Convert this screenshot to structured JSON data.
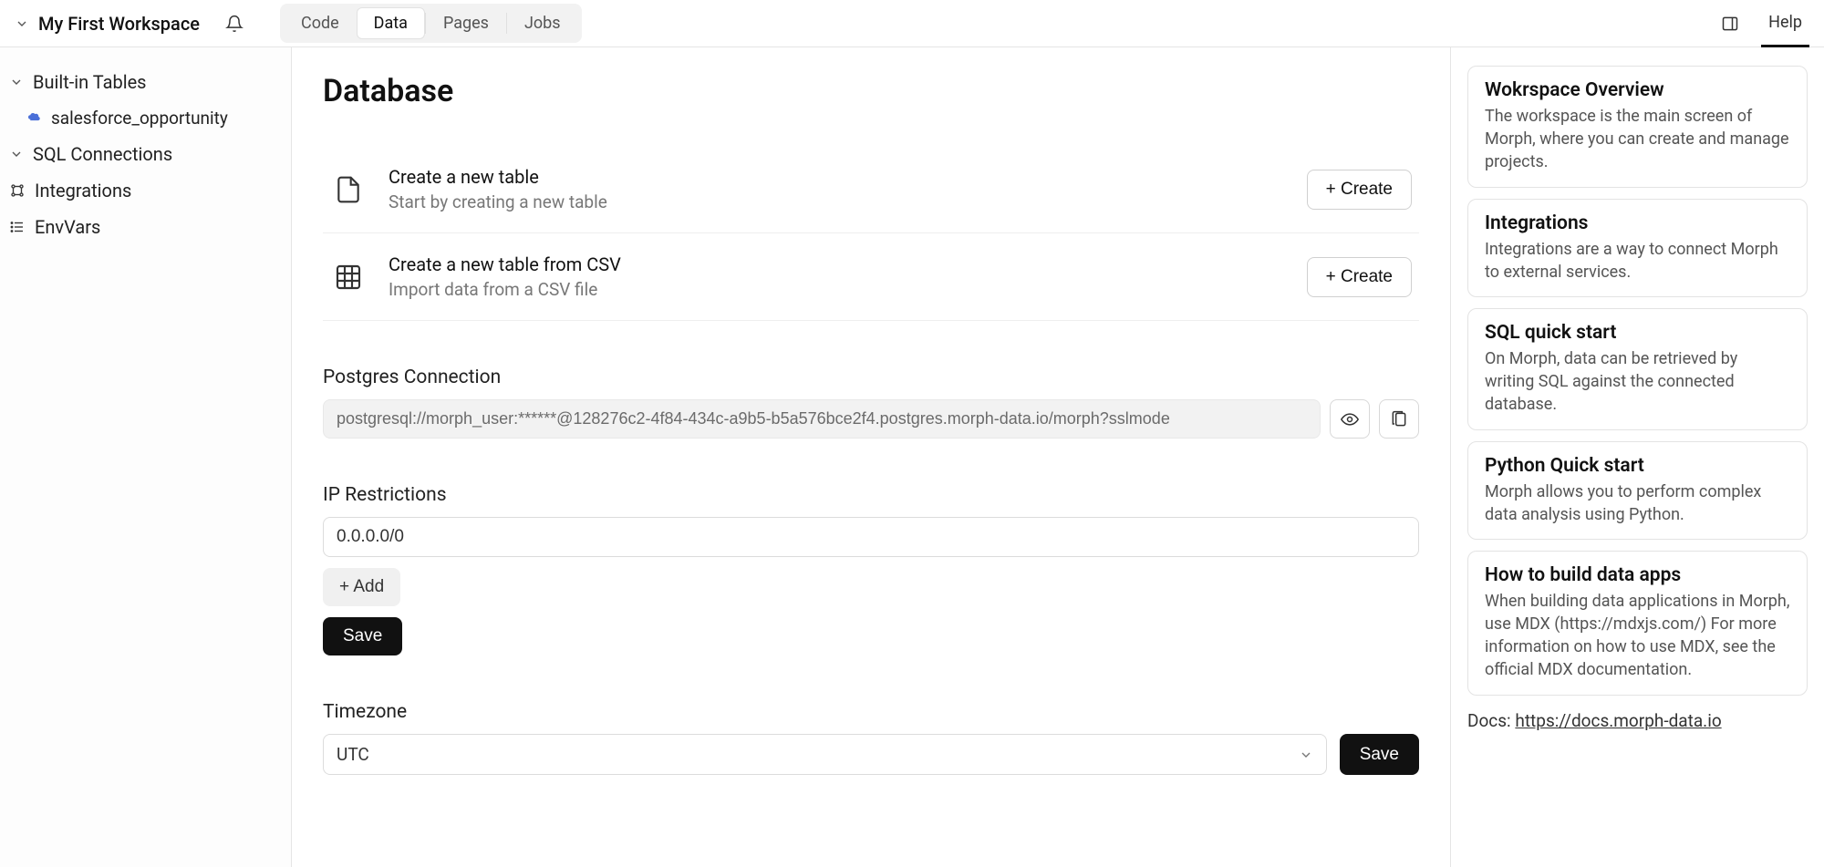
{
  "header": {
    "workspace_title": "My First Workspace",
    "tabs": {
      "code": "Code",
      "data": "Data",
      "pages": "Pages",
      "jobs": "Jobs"
    },
    "help_tab": "Help"
  },
  "sidebar": {
    "builtin_tables": {
      "label": "Built-in Tables",
      "children": [
        "salesforce_opportunity"
      ]
    },
    "sql_connections": {
      "label": "SQL Connections"
    },
    "integrations": {
      "label": "Integrations"
    },
    "envvars": {
      "label": "EnvVars"
    }
  },
  "main": {
    "heading": "Database",
    "create_table": {
      "title": "Create a new table",
      "subtitle": "Start by creating a new table",
      "button": "+ Create"
    },
    "create_csv": {
      "title": "Create a new table from CSV",
      "subtitle": "Import data from a CSV file",
      "button": "+ Create"
    },
    "postgres": {
      "label": "Postgres Connection",
      "value": "postgresql://morph_user:******@128276c2-4f84-434c-a9b5-b5a576bce2f4.postgres.morph-data.io/morph?sslmode"
    },
    "ip": {
      "label": "IP Restrictions",
      "value": "0.0.0.0/0",
      "add_button": "+ Add",
      "save_button": "Save"
    },
    "timezone": {
      "label": "Timezone",
      "value": "UTC",
      "save_button": "Save"
    }
  },
  "help": {
    "cards": [
      {
        "title": "Wokrspace Overview",
        "body": "The workspace is the main screen of Morph, where you can create and manage projects."
      },
      {
        "title": "Integrations",
        "body": "Integrations are a way to connect Morph to external services."
      },
      {
        "title": "SQL quick start",
        "body": "On Morph, data can be retrieved by writing SQL against the connected database."
      },
      {
        "title": "Python Quick start",
        "body": "Morph allows you to perform complex data analysis using Python."
      },
      {
        "title": "How to build data apps",
        "body": "When building data applications in Morph, use MDX (https://mdxjs.com/) For more information on how to use MDX, see the official MDX documentation."
      }
    ],
    "docs_prefix": "Docs: ",
    "docs_link": "https://docs.morph-data.io"
  }
}
